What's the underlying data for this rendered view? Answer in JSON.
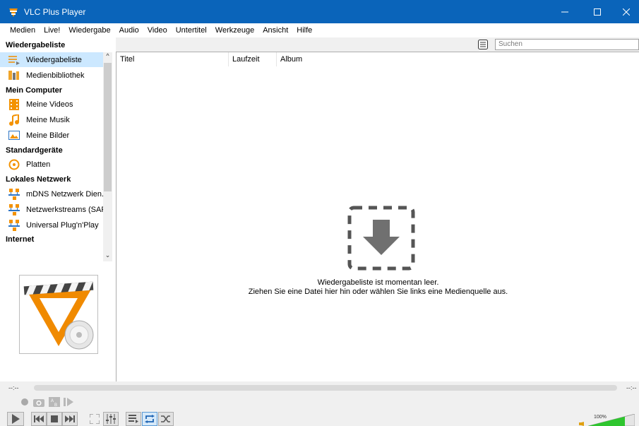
{
  "window": {
    "title": "VLC Plus Player",
    "controls": [
      "minimize",
      "maximize",
      "close"
    ]
  },
  "menu": [
    "Medien",
    "Live!",
    "Wiedergabe",
    "Audio",
    "Video",
    "Untertitel",
    "Werkzeuge",
    "Ansicht",
    "Hilfe"
  ],
  "sidebar": {
    "header": "Wiedergabeliste",
    "items": [
      {
        "label": "Wiedergabeliste",
        "icon": "playlist-icon",
        "selected": true
      },
      {
        "label": "Medienbibliothek",
        "icon": "media-library-icon"
      }
    ],
    "categories": [
      {
        "label": "Mein Computer",
        "items": [
          {
            "label": "Meine Videos",
            "icon": "film-icon"
          },
          {
            "label": "Meine Musik",
            "icon": "music-note-icon"
          },
          {
            "label": "Meine Bilder",
            "icon": "picture-icon"
          }
        ]
      },
      {
        "label": "Standardgeräte",
        "items": [
          {
            "label": "Platten",
            "icon": "disc-icon"
          }
        ]
      },
      {
        "label": "Lokales Netzwerk",
        "items": [
          {
            "label": "mDNS Netzwerk Dien...",
            "icon": "network-icon"
          },
          {
            "label": "Netzwerkstreams (SAP)",
            "icon": "network-icon"
          },
          {
            "label": "Universal Plug'n'Play",
            "icon": "network-icon"
          }
        ]
      },
      {
        "label": "Internet",
        "items": []
      }
    ],
    "album_art": "vlc-cone-logo"
  },
  "playlist": {
    "search_placeholder": "Suchen",
    "columns": [
      "Titel",
      "Laufzeit",
      "Album"
    ],
    "empty_line1": "Wiedergabeliste ist momentan leer.",
    "empty_line2": "Ziehen Sie eine Datei hier hin oder wählen Sie links eine Medienquelle aus."
  },
  "player": {
    "time_elapsed": "--:--",
    "time_total": "--:--",
    "volume": "100%"
  },
  "colors": {
    "titlebar": "#0a64ba",
    "selection": "#cce8ff",
    "vlc_orange": "#f08a00",
    "volume_green": "#2ec52e"
  }
}
